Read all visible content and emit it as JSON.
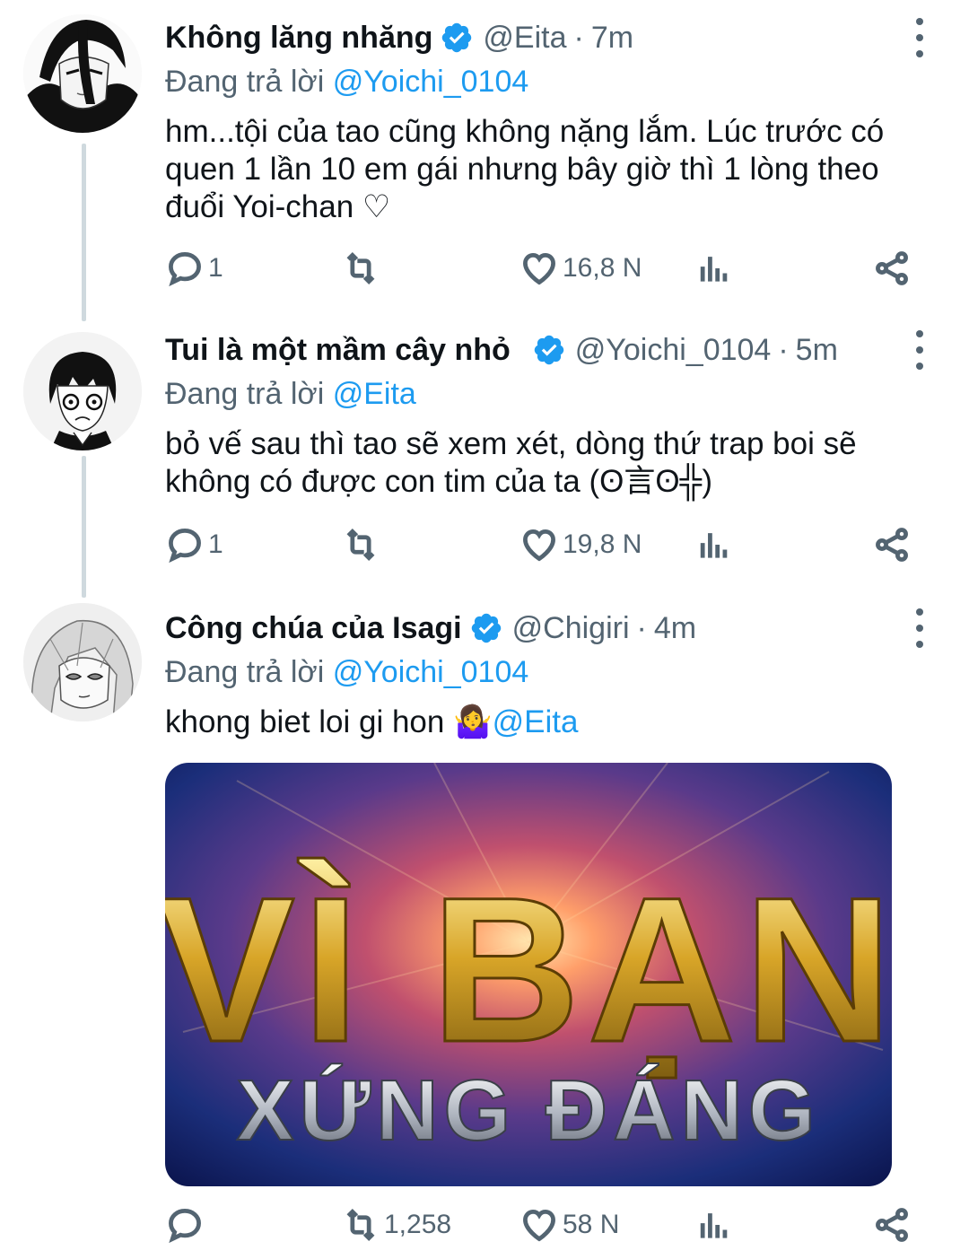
{
  "tweets": [
    {
      "name": "Không lăng nhăng",
      "handle": "@Eita",
      "dot": "·",
      "time": "7m",
      "replying_prefix": "Đang trả lời",
      "replying_to": "@Yoichi_0104",
      "text": "hm...tội của tao cũng không nặng lắm. Lúc trước có quen 1 lần 10 em gái nhưng bây giờ thì 1 lòng theo đuổi Yoi-chan ♡",
      "replies": "1",
      "retweets": "",
      "likes": "16,8 N"
    },
    {
      "name": "Tui là một mầm cây nhỏ",
      "handle": "@Yoichi_0104",
      "dot": "·",
      "time": "5m",
      "replying_prefix": "Đang trả lời",
      "replying_to": "@Eita",
      "text": "bỏ vế sau thì tao sẽ xem xét, dòng thứ trap boi sẽ không có được con tim của ta (ʘ言ʘ╬)",
      "replies": "1",
      "retweets": "",
      "likes": "19,8 N"
    },
    {
      "name": "Công chúa của Isagi",
      "handle": "@Chigiri",
      "dot": "·",
      "time": "4m",
      "replying_prefix": "Đang trả lời",
      "replying_to": "@Yoichi_0104",
      "text": "khong biet loi gi hon 🤷‍♀️",
      "text_mention": "@Eita",
      "replies": "",
      "retweets": "1,258",
      "likes": "58 N",
      "media": {
        "line1": "VÌ BẠN",
        "line2": "XỨNG ĐÁNG"
      }
    }
  ],
  "icons": {
    "verified": "verified-badge-icon",
    "reply": "reply-icon",
    "retweet": "retweet-icon",
    "like": "heart-icon",
    "analytics": "analytics-icon",
    "share": "share-icon",
    "more": "more-vertical-icon"
  },
  "colors": {
    "accent": "#1d9bf0",
    "muted": "#536471",
    "text": "#0f1419"
  }
}
